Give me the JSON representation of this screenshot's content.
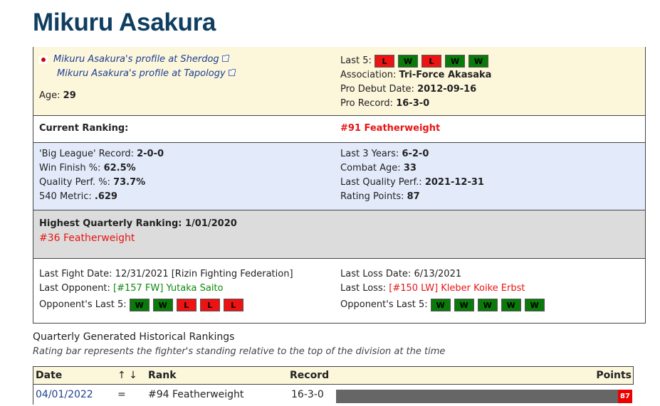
{
  "fighter": {
    "name": "Mikuru Asakura"
  },
  "profile": {
    "sherdog_link": "Mikuru Asakura's profile at Sherdog",
    "tapology_link": "Mikuru Asakura's profile at Tapology",
    "age_label": "Age:",
    "age": "29",
    "last5_label": "Last 5:",
    "last5": [
      "L",
      "W",
      "L",
      "W",
      "W"
    ],
    "association_label": "Association:",
    "association": "Tri-Force Akasaka",
    "pro_debut_label": "Pro Debut Date:",
    "pro_debut": "2012-09-16",
    "pro_record_label": "Pro Record:",
    "pro_record": "16-3-0"
  },
  "ranking": {
    "label": "Current Ranking:",
    "value": "#91 Featherweight"
  },
  "stats": {
    "big_league_label": "'Big League' Record:",
    "big_league": "2-0-0",
    "win_finish_label": "Win Finish %:",
    "win_finish": "62.5%",
    "quality_perf_label": "Quality Perf. %:",
    "quality_perf": "73.7%",
    "metric_label": "540 Metric:",
    "metric": ".629",
    "last3_label": "Last 3 Years:",
    "last3": "6-2-0",
    "combat_age_label": "Combat Age:",
    "combat_age": "33",
    "last_quality_label": "Last Quality Perf.:",
    "last_quality": "2021-12-31",
    "rating_points_label": "Rating Points:",
    "rating_points": "87"
  },
  "highest": {
    "label": "Highest Quarterly Ranking: 1/01/2020",
    "value": "#36 Featherweight"
  },
  "last_fight": {
    "date_label": "Last Fight Date:",
    "date": "12/31/2021 [Rizin Fighting Federation]",
    "opponent_label": "Last Opponent:",
    "opponent": "[#157 FW] Yutaka Saito",
    "opp_last5_label": "Opponent's Last 5:",
    "opp_last5": [
      "W",
      "W",
      "L",
      "L",
      "L"
    ],
    "loss_date_label": "Last Loss Date:",
    "loss_date": "6/13/2021",
    "loss_label": "Last Loss:",
    "loss": "[#150 LW] Kleber Koike Erbst",
    "loss_opp_last5_label": "Opponent's Last 5:",
    "loss_opp_last5": [
      "W",
      "W",
      "W",
      "W",
      "W"
    ]
  },
  "history": {
    "title": "Quarterly Generated Historical Rankings",
    "subtitle": "Rating bar represents the fighter's standing relative to the top of the division at the time",
    "headers": {
      "date": "Date",
      "sort": "↑ ↓",
      "rank": "Rank",
      "record": "Record",
      "points": "Points"
    },
    "rows": [
      {
        "date": "04/01/2022",
        "change": "=",
        "rank": "#94 Featherweight",
        "record": "16-3-0",
        "points": "87"
      }
    ]
  },
  "colors": {
    "title": "#0f3e60",
    "win": "#0a7a0a",
    "loss": "#ee1313",
    "profile_bg": "#fcf6db",
    "stats_bg": "#e3ebfb",
    "highest_bg": "#dcdcdc"
  }
}
